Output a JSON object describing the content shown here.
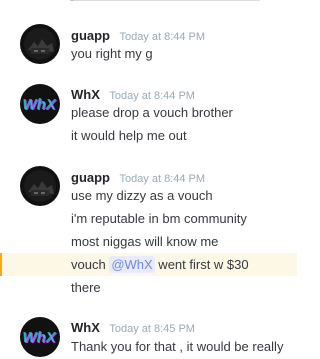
{
  "messages": [
    {
      "author": "guapp",
      "timestamp": "Today at 8:44 PM",
      "avatar_icon": "guapp-avatar-icon",
      "lines": [
        "you right my g"
      ]
    },
    {
      "author": "WhX",
      "timestamp": "Today at 8:44 PM",
      "avatar_icon": "whx-avatar-icon",
      "lines": [
        "please drop a vouch brother",
        "it would help me out"
      ]
    },
    {
      "author": "guapp",
      "timestamp": "Today at 8:44 PM",
      "avatar_icon": "guapp-avatar-icon",
      "lines": [
        "use my dizzy as a vouch",
        "i'm reputable in bm community",
        "most niggas will know me"
      ],
      "highlighted_line": {
        "before": "vouch ",
        "mention": "@WhX",
        "after": " went first w $30"
      },
      "last_line": "there"
    },
    {
      "author": "WhX",
      "timestamp": "Today at 8:45 PM",
      "avatar_icon": "whx-avatar-icon",
      "lines": [
        "Thank you for that , it would be really"
      ]
    }
  ],
  "colors": {
    "mention_bg": "#e9ebfb",
    "mention_text": "#7289da",
    "highlight_bg": "#fdf7e6",
    "highlight_border": "#f5a623"
  }
}
